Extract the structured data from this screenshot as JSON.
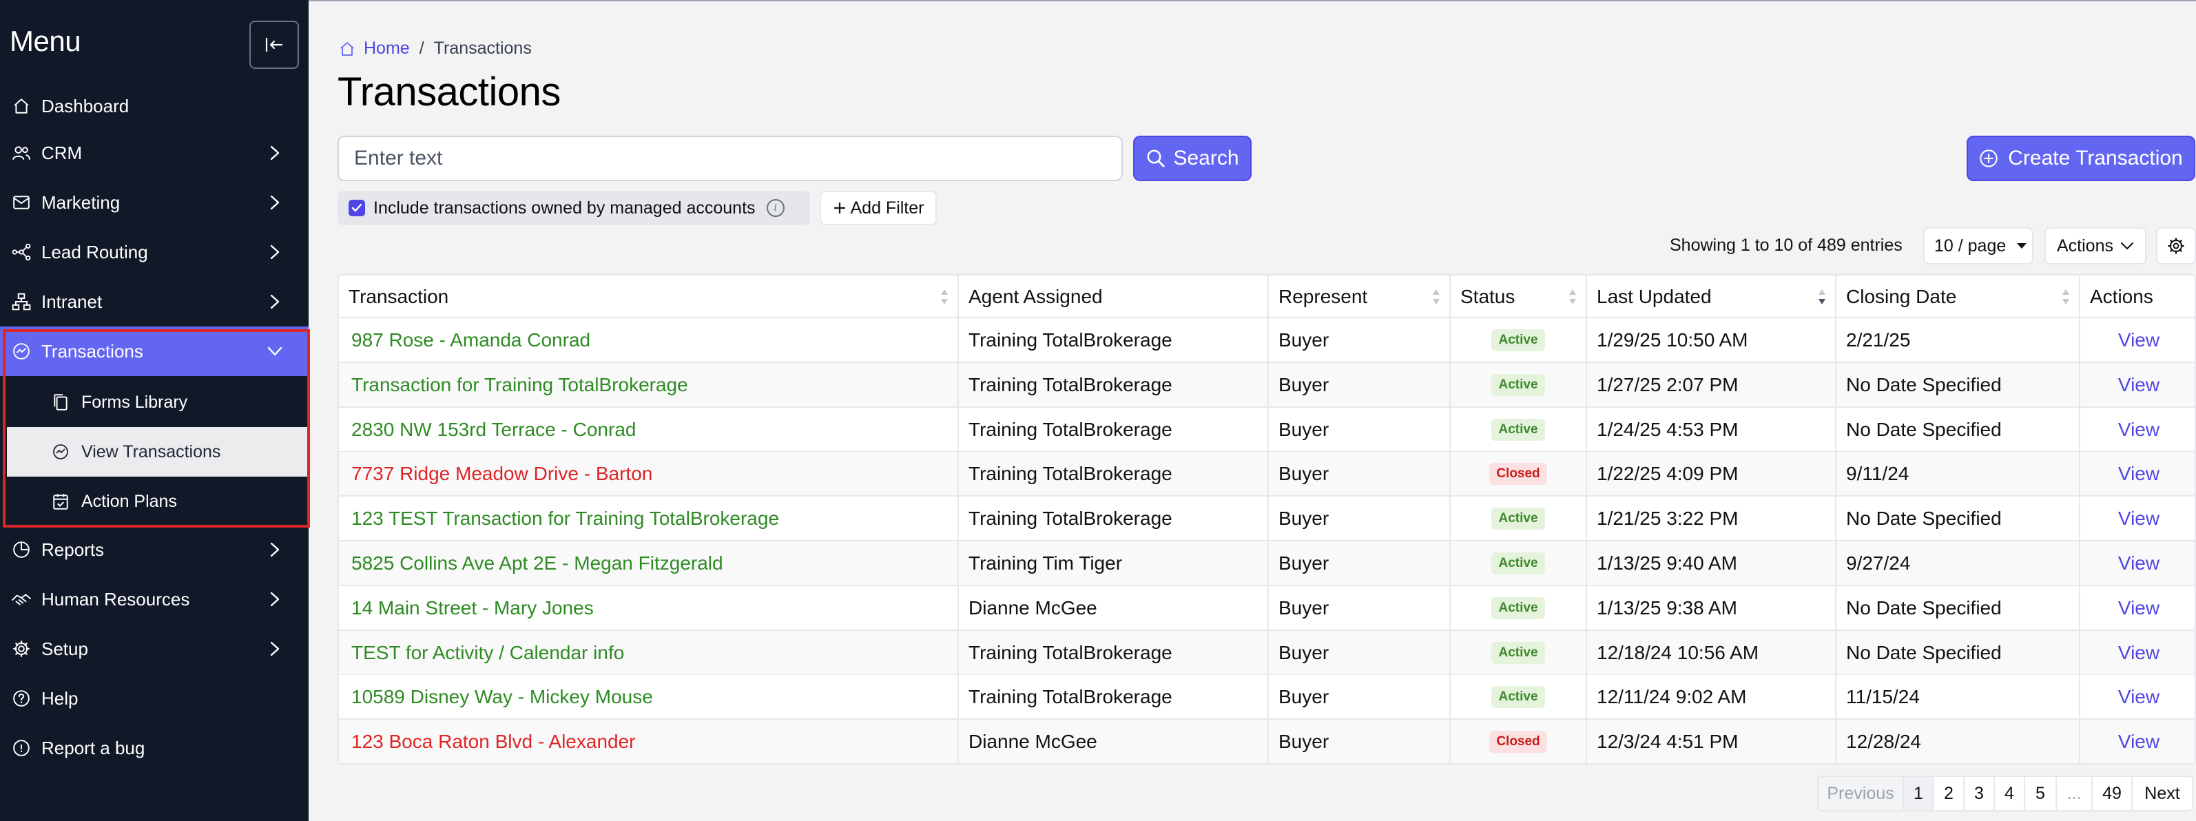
{
  "sidebar": {
    "title": "Menu",
    "items": [
      {
        "label": "Dashboard",
        "icon": "home-icon"
      },
      {
        "label": "CRM",
        "icon": "users-icon"
      },
      {
        "label": "Marketing",
        "icon": "mail-icon"
      },
      {
        "label": "Lead Routing",
        "icon": "routing-icon"
      },
      {
        "label": "Intranet",
        "icon": "network-icon"
      },
      {
        "label": "Transactions",
        "icon": "transactions-icon"
      },
      {
        "label": "Reports",
        "icon": "chart-pie-icon"
      },
      {
        "label": "Human Resources",
        "icon": "handshake-icon"
      },
      {
        "label": "Setup",
        "icon": "gear-icon"
      },
      {
        "label": "Help",
        "icon": "help-circle-icon"
      },
      {
        "label": "Report a bug",
        "icon": "bug-icon"
      }
    ],
    "subitems": [
      {
        "label": "Forms Library",
        "icon": "copy-icon"
      },
      {
        "label": "View Transactions",
        "icon": "transactions-icon"
      },
      {
        "label": "Action Plans",
        "icon": "calendar-check-icon"
      }
    ]
  },
  "breadcrumb": {
    "home": "Home",
    "separator": "/",
    "current": "Transactions"
  },
  "page_title": "Transactions",
  "search": {
    "placeholder": "Enter text",
    "button": "Search"
  },
  "create_button": "Create Transaction",
  "filters": {
    "include_managed": "Include transactions owned by managed accounts",
    "include_checked": true,
    "add_filter": "Add Filter"
  },
  "showing": "Showing 1 to 10 of 489 entries",
  "per_page": "10 / page",
  "actions_dropdown": "Actions",
  "table": {
    "headers": [
      "Transaction",
      "Agent Assigned",
      "Represent",
      "Status",
      "Last Updated",
      "Closing Date",
      "Actions"
    ],
    "rows": [
      {
        "transaction": "987 Rose - Amanda Conrad",
        "agent": "Training TotalBrokerage",
        "represent": "Buyer",
        "status": "Active",
        "updated": "1/29/25 10:50 AM",
        "closing": "2/21/25",
        "action": "View"
      },
      {
        "transaction": "Transaction for Training TotalBrokerage",
        "agent": "Training TotalBrokerage",
        "represent": "Buyer",
        "status": "Active",
        "updated": "1/27/25 2:07 PM",
        "closing": "No Date Specified",
        "action": "View"
      },
      {
        "transaction": "2830 NW 153rd Terrace - Conrad",
        "agent": "Training TotalBrokerage",
        "represent": "Buyer",
        "status": "Active",
        "updated": "1/24/25 4:53 PM",
        "closing": "No Date Specified",
        "action": "View"
      },
      {
        "transaction": "7737 Ridge Meadow Drive - Barton",
        "agent": "Training TotalBrokerage",
        "represent": "Buyer",
        "status": "Closed",
        "updated": "1/22/25 4:09 PM",
        "closing": "9/11/24",
        "action": "View"
      },
      {
        "transaction": "123 TEST Transaction for Training TotalBrokerage",
        "agent": "Training TotalBrokerage",
        "represent": "Buyer",
        "status": "Active",
        "updated": "1/21/25 3:22 PM",
        "closing": "No Date Specified",
        "action": "View"
      },
      {
        "transaction": "5825 Collins Ave Apt 2E - Megan Fitzgerald",
        "agent": "Training Tim Tiger",
        "represent": "Buyer",
        "status": "Active",
        "updated": "1/13/25 9:40 AM",
        "closing": "9/27/24",
        "action": "View"
      },
      {
        "transaction": "14 Main Street - Mary Jones",
        "agent": "Dianne McGee",
        "represent": "Buyer",
        "status": "Active",
        "updated": "1/13/25 9:38 AM",
        "closing": "No Date Specified",
        "action": "View"
      },
      {
        "transaction": "TEST for Activity / Calendar info",
        "agent": "Training TotalBrokerage",
        "represent": "Buyer",
        "status": "Active",
        "updated": "12/18/24 10:56 AM",
        "closing": "No Date Specified",
        "action": "View"
      },
      {
        "transaction": "10589 Disney Way - Mickey Mouse",
        "agent": "Training TotalBrokerage",
        "represent": "Buyer",
        "status": "Active",
        "updated": "12/11/24 9:02 AM",
        "closing": "11/15/24",
        "action": "View"
      },
      {
        "transaction": "123 Boca Raton Blvd - Alexander",
        "agent": "Dianne McGee",
        "represent": "Buyer",
        "status": "Closed",
        "updated": "12/3/24 4:51 PM",
        "closing": "12/28/24",
        "action": "View"
      }
    ]
  },
  "pagination": {
    "previous": "Previous",
    "pages": [
      "1",
      "2",
      "3",
      "4",
      "5"
    ],
    "ellipsis": "...",
    "last": "49",
    "next": "Next",
    "current": "1"
  },
  "colors": {
    "sidebar_bg": "#111827",
    "accent": "#6366f1",
    "active_green": "#2e8b23",
    "closed_red": "#e02424",
    "highlight_border": "#dc2626"
  }
}
